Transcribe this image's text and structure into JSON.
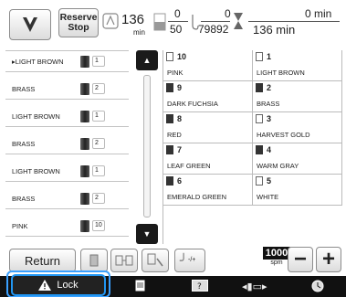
{
  "top": {
    "reserve_stop": [
      "Reserve",
      "Stop"
    ],
    "stitch_count": "136",
    "stitch_unit": "min",
    "current_stitch_top": "0",
    "current_stitch_bottom": "50",
    "total_stitch_top": "0",
    "total_stitch_bottom": "79892",
    "time_top": "0 min",
    "time_bottom": "136 min"
  },
  "color_list": [
    {
      "name": "LIGHT BROWN",
      "number": "1",
      "current": true
    },
    {
      "name": "BRASS",
      "number": "2"
    },
    {
      "name": "LIGHT BROWN",
      "number": "1"
    },
    {
      "name": "BRASS",
      "number": "2"
    },
    {
      "name": "LIGHT BROWN",
      "number": "1"
    },
    {
      "name": "BRASS",
      "number": "2"
    },
    {
      "name": "PINK",
      "number": "10"
    }
  ],
  "thread_table": [
    {
      "left": {
        "num": "10",
        "name": "PINK",
        "shade": "light"
      },
      "right": {
        "num": "1",
        "name": "LIGHT BROWN",
        "shade": "light"
      }
    },
    {
      "left": {
        "num": "9",
        "name": "DARK FUCHSIA",
        "shade": "dark"
      },
      "right": {
        "num": "2",
        "name": "BRASS",
        "shade": "dark"
      }
    },
    {
      "left": {
        "num": "8",
        "name": "RED",
        "shade": "dark"
      },
      "right": {
        "num": "3",
        "name": "HARVEST GOLD",
        "shade": "light"
      }
    },
    {
      "left": {
        "num": "7",
        "name": "LEAF GREEN",
        "shade": "dark"
      },
      "right": {
        "num": "4",
        "name": "WARM GRAY",
        "shade": "dark"
      }
    },
    {
      "left": {
        "num": "6",
        "name": "EMERALD GREEN",
        "shade": "dark"
      },
      "right": {
        "num": "5",
        "name": "WHITE",
        "shade": "light"
      }
    }
  ],
  "controls": {
    "return_label": "Return",
    "speed_value": "1000",
    "speed_unit": "spm",
    "minus_label": "−",
    "plus_label": "+",
    "needle_adjust_label": "-/+"
  },
  "bottom": {
    "lock_label": "Lock",
    "accent": "#2196f3"
  }
}
